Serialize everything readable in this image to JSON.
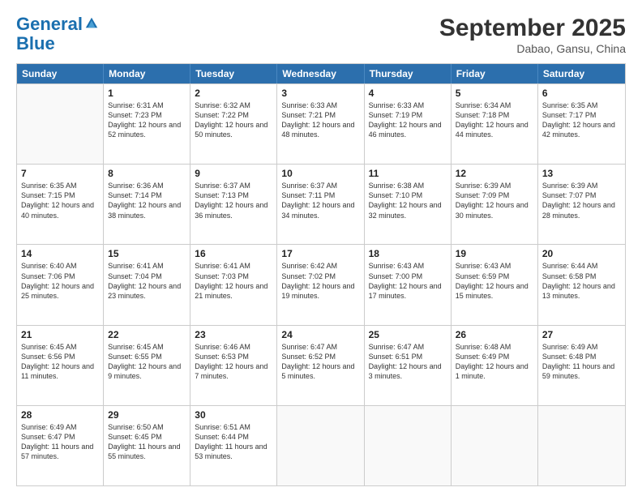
{
  "header": {
    "logo_line1": "General",
    "logo_line2": "Blue",
    "month": "September 2025",
    "location": "Dabao, Gansu, China"
  },
  "days": [
    "Sunday",
    "Monday",
    "Tuesday",
    "Wednesday",
    "Thursday",
    "Friday",
    "Saturday"
  ],
  "rows": [
    [
      {
        "day": "",
        "empty": true
      },
      {
        "day": "1",
        "sunrise": "6:31 AM",
        "sunset": "7:23 PM",
        "daylight": "12 hours and 52 minutes."
      },
      {
        "day": "2",
        "sunrise": "6:32 AM",
        "sunset": "7:22 PM",
        "daylight": "12 hours and 50 minutes."
      },
      {
        "day": "3",
        "sunrise": "6:33 AM",
        "sunset": "7:21 PM",
        "daylight": "12 hours and 48 minutes."
      },
      {
        "day": "4",
        "sunrise": "6:33 AM",
        "sunset": "7:19 PM",
        "daylight": "12 hours and 46 minutes."
      },
      {
        "day": "5",
        "sunrise": "6:34 AM",
        "sunset": "7:18 PM",
        "daylight": "12 hours and 44 minutes."
      },
      {
        "day": "6",
        "sunrise": "6:35 AM",
        "sunset": "7:17 PM",
        "daylight": "12 hours and 42 minutes."
      }
    ],
    [
      {
        "day": "7",
        "sunrise": "6:35 AM",
        "sunset": "7:15 PM",
        "daylight": "12 hours and 40 minutes."
      },
      {
        "day": "8",
        "sunrise": "6:36 AM",
        "sunset": "7:14 PM",
        "daylight": "12 hours and 38 minutes."
      },
      {
        "day": "9",
        "sunrise": "6:37 AM",
        "sunset": "7:13 PM",
        "daylight": "12 hours and 36 minutes."
      },
      {
        "day": "10",
        "sunrise": "6:37 AM",
        "sunset": "7:11 PM",
        "daylight": "12 hours and 34 minutes."
      },
      {
        "day": "11",
        "sunrise": "6:38 AM",
        "sunset": "7:10 PM",
        "daylight": "12 hours and 32 minutes."
      },
      {
        "day": "12",
        "sunrise": "6:39 AM",
        "sunset": "7:09 PM",
        "daylight": "12 hours and 30 minutes."
      },
      {
        "day": "13",
        "sunrise": "6:39 AM",
        "sunset": "7:07 PM",
        "daylight": "12 hours and 28 minutes."
      }
    ],
    [
      {
        "day": "14",
        "sunrise": "6:40 AM",
        "sunset": "7:06 PM",
        "daylight": "12 hours and 25 minutes."
      },
      {
        "day": "15",
        "sunrise": "6:41 AM",
        "sunset": "7:04 PM",
        "daylight": "12 hours and 23 minutes."
      },
      {
        "day": "16",
        "sunrise": "6:41 AM",
        "sunset": "7:03 PM",
        "daylight": "12 hours and 21 minutes."
      },
      {
        "day": "17",
        "sunrise": "6:42 AM",
        "sunset": "7:02 PM",
        "daylight": "12 hours and 19 minutes."
      },
      {
        "day": "18",
        "sunrise": "6:43 AM",
        "sunset": "7:00 PM",
        "daylight": "12 hours and 17 minutes."
      },
      {
        "day": "19",
        "sunrise": "6:43 AM",
        "sunset": "6:59 PM",
        "daylight": "12 hours and 15 minutes."
      },
      {
        "day": "20",
        "sunrise": "6:44 AM",
        "sunset": "6:58 PM",
        "daylight": "12 hours and 13 minutes."
      }
    ],
    [
      {
        "day": "21",
        "sunrise": "6:45 AM",
        "sunset": "6:56 PM",
        "daylight": "12 hours and 11 minutes."
      },
      {
        "day": "22",
        "sunrise": "6:45 AM",
        "sunset": "6:55 PM",
        "daylight": "12 hours and 9 minutes."
      },
      {
        "day": "23",
        "sunrise": "6:46 AM",
        "sunset": "6:53 PM",
        "daylight": "12 hours and 7 minutes."
      },
      {
        "day": "24",
        "sunrise": "6:47 AM",
        "sunset": "6:52 PM",
        "daylight": "12 hours and 5 minutes."
      },
      {
        "day": "25",
        "sunrise": "6:47 AM",
        "sunset": "6:51 PM",
        "daylight": "12 hours and 3 minutes."
      },
      {
        "day": "26",
        "sunrise": "6:48 AM",
        "sunset": "6:49 PM",
        "daylight": "12 hours and 1 minute."
      },
      {
        "day": "27",
        "sunrise": "6:49 AM",
        "sunset": "6:48 PM",
        "daylight": "11 hours and 59 minutes."
      }
    ],
    [
      {
        "day": "28",
        "sunrise": "6:49 AM",
        "sunset": "6:47 PM",
        "daylight": "11 hours and 57 minutes."
      },
      {
        "day": "29",
        "sunrise": "6:50 AM",
        "sunset": "6:45 PM",
        "daylight": "11 hours and 55 minutes."
      },
      {
        "day": "30",
        "sunrise": "6:51 AM",
        "sunset": "6:44 PM",
        "daylight": "11 hours and 53 minutes."
      },
      {
        "day": "",
        "empty": true
      },
      {
        "day": "",
        "empty": true
      },
      {
        "day": "",
        "empty": true
      },
      {
        "day": "",
        "empty": true
      }
    ]
  ]
}
